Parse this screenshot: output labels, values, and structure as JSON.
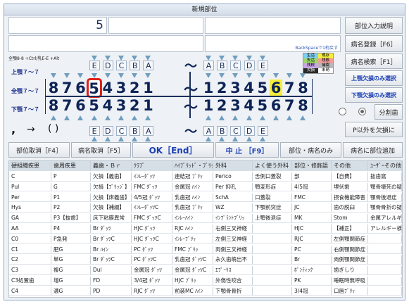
{
  "window": {
    "title": "新規部位"
  },
  "input": {
    "value": "5"
  },
  "backspace_hint": "BackSpaceで1桁戻す",
  "right_buttons": {
    "part_input_help": "部位入力説明",
    "disease_register": "病名登録［F6］",
    "disease_search": "病名検索［F1］",
    "upper_missing_only": "上顎欠損のみ選択",
    "lower_missing_only": "下顎欠損のみ選択",
    "split_tooth": "分割歯",
    "p_exclude_missing": "P以外を欠損に"
  },
  "shortcut_hint": "全顎8-8 +Ctrl/乳E-E +Alt",
  "legend": {
    "rows": [
      [
        "生活",
        "現存"
      ],
      [
        "失活",
        "残根"
      ],
      [
        "残根",
        "補綴"
      ],
      [
        "欠損",
        "未萌"
      ]
    ],
    "colors": [
      "#7fd0f0",
      "#f6ee3a",
      "#9fd86a",
      "#f09a9a",
      "#c7a5e8",
      "#b7b7b7",
      "#2a2a2a",
      "#ffffff"
    ]
  },
  "jaw_labels": {
    "upper": "上顎７～７",
    "full": "全顎７～７",
    "lower": "下顎７～７"
  },
  "chart": {
    "letters_right": [
      "E",
      "D",
      "C",
      "B",
      "A"
    ],
    "letters_left": [
      "A",
      "B",
      "C",
      "D",
      "E"
    ],
    "upper_right": [
      "8",
      "7",
      "6",
      "5",
      "4",
      "3",
      "2",
      "1"
    ],
    "upper_left": [
      "1",
      "2",
      "3",
      "4",
      "5",
      "6",
      "7",
      "8"
    ],
    "lower_right": [
      "8",
      "7",
      "6",
      "5",
      "4",
      "3",
      "2",
      "1"
    ],
    "lower_left": [
      "1",
      "2",
      "3",
      "4",
      "5",
      "6",
      "7",
      "8"
    ],
    "tilde": "～",
    "selected_tooth": "upper-right-5",
    "highlight_tooth": "upper-left-6"
  },
  "symbols": {
    "comma": ",",
    "arrow": "→",
    "paren": "( )"
  },
  "bottom_buttons": {
    "cancel_part": "部位取消［F4］",
    "cancel_disease": "病名取消［F5］",
    "ok": "OK［End］",
    "stop": "中 止 ［F9］",
    "part_disease_only": "部位・病名のみ",
    "add_disease_part": "病名に部位追加"
  },
  "grid": {
    "headers": [
      "硬組織疾患",
      "歯周疾患",
      "義歯・Ｂｒ",
      "ｸﾗﾌﾞ",
      "ﾊｲﾌﾞﾘｯﾄﾞ・ﾌﾞﾘｯｼﾞ",
      "外科",
      "よく使う外科",
      "部位・修飾語",
      "その他",
      "ﾕｰｻﾞｰその他"
    ],
    "columns": [
      [
        "C",
        "Pul",
        "Per",
        "Hys",
        "GA",
        "AA",
        "C0",
        "C1",
        "C2",
        "C3",
        "C3処置歯",
        "C4"
      ],
      [
        "P",
        "G",
        "P1",
        "P2",
        "P3【抜歯】",
        "P4",
        "P急発",
        "肥G",
        "単G",
        "複G",
        "増G",
        "濃G"
      ],
      [
        "欠損【義歯】",
        "欠損【ﾌﾞﾘｯｼﾞ】",
        "欠損【床義歯】",
        "欠損【補綴】",
        "床下粘膜異常",
        "Br ﾀﾞｯﾂ",
        "Br ﾀﾞｯﾂC",
        "Br ﾊｲﾝ",
        "Br ﾀﾞｯﾂC",
        "Dul",
        "FD",
        "PD"
      ],
      [
        "ｲﾝﾚｰﾀﾞｯﾂ",
        "FMC ﾀﾞｯﾂ",
        "4/5冠 ﾀﾞｯﾂ",
        "ｲﾝﾚｰﾀﾞｯﾂC",
        "FMC ﾀﾞｯﾂC",
        "HJC ﾀﾞｯﾂ",
        "HJC ﾀﾞｯﾂC",
        "PC ﾀﾞｯﾂ",
        "PC ﾀﾞｯﾂC",
        "金属冠 ﾀﾞｯﾂ",
        "3/4冠 ﾀﾞｯﾂ",
        "RJC ﾀﾞｯﾂ"
      ],
      [
        "連結冠 ﾌﾞﾘｯ",
        "金属冠 ﾊｲﾝ",
        "乳歯冠 ﾊｲﾝ",
        "乳歯冠 ﾌﾞﾘｯ",
        "ｲﾝﾚｰﾊｲﾝ",
        "RJC ﾊｲﾝ",
        "ｲﾝﾚｰﾌﾞﾘｯ",
        "FMC ﾌﾞﾘｯ",
        "乳歯冠 ﾀﾞｯﾂC",
        "金属冠 ﾀﾞｯﾂC",
        "HJC ﾌﾞﾘｯ",
        "前装MC ﾊｲﾝ"
      ],
      [
        "Perico",
        "Per 抑孔",
        "SchA",
        "WZ",
        "ｲﾝﾌﾟﾗﾝﾄﾌﾞﾘｯ",
        "右側三叉神経",
        "左側三叉神経",
        "両側三叉神経",
        "永久歯萌出不",
        "ｴﾌﾟｰﾘｽ",
        "外傷性咬合",
        "下顎骨骨折"
      ],
      [
        "舌側口蓋裂",
        "顎変形症",
        "口蓋裂",
        "下顎前突症",
        "上顎後退症",
        "",
        "",
        "",
        "",
        "",
        "",
        ""
      ],
      [
        "部",
        "4/5冠",
        "FMC",
        "JC",
        "MK",
        "HJC",
        "RJC",
        "PC",
        "Br",
        "ﾎﾟﾝﾃｨｯｸ",
        "PK",
        "3/4冠"
      ],
      [
        "【自費】",
        "埋伏歯",
        "摂食機能障害",
        "歯の脱臼",
        "Stom",
        "【補正】",
        "左側顎関節症",
        "右側顎関節症",
        "両側顎関節症",
        "歯ぎしり",
        "睡眠時無呼吸",
        "口唇ﾌﾞﾘｯ"
      ],
      [
        "抜歯窩",
        "顎骨壊死の疑",
        "顎骨後退症",
        "顎骨骨折の疑",
        "金属アレルギー",
        "アレルギー検査",
        "",
        "",
        "",
        "",
        "",
        ""
      ]
    ]
  }
}
